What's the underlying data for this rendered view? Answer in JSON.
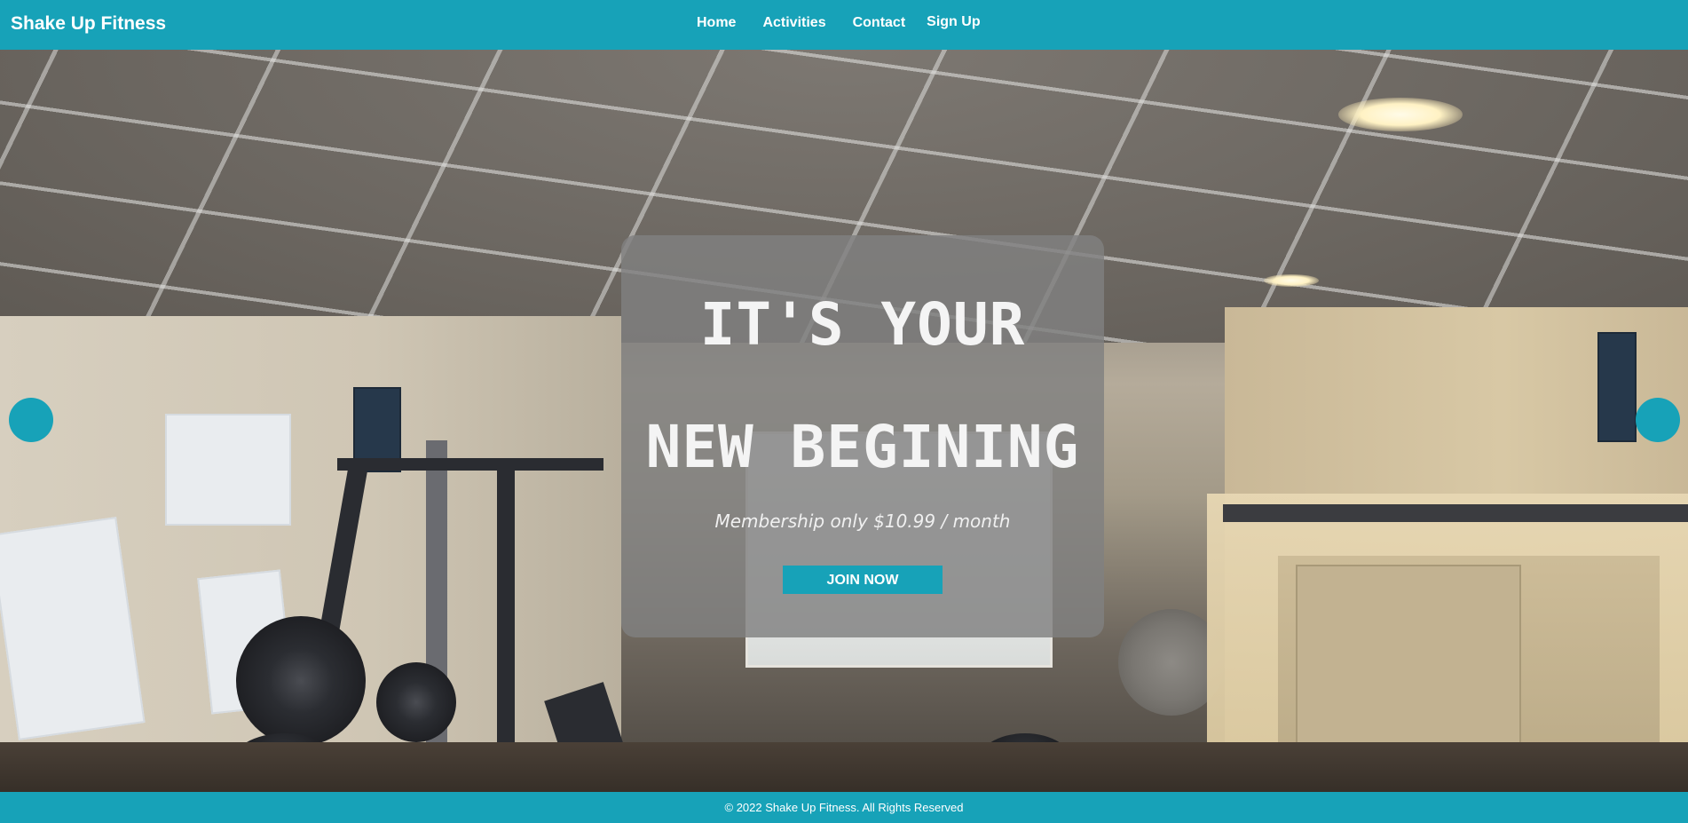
{
  "navbar": {
    "brand": "Shake Up Fitness",
    "links": [
      {
        "label": "Home"
      },
      {
        "label": "Activities"
      },
      {
        "label": "Contact"
      },
      {
        "label": "Sign Up"
      }
    ],
    "color": "#17a2b8"
  },
  "hero": {
    "headline_line1": "IT'S YOUR",
    "headline_line2": "NEW BEGINING",
    "tagline": "Membership only $10.99 / month",
    "cta_label": "JOIN NOW"
  },
  "carousel": {
    "prev_icon": "circle-prev-icon",
    "next_icon": "circle-next-icon"
  },
  "footer": {
    "text": "© 2022 Shake Up Fitness. All Rights Reserved"
  }
}
